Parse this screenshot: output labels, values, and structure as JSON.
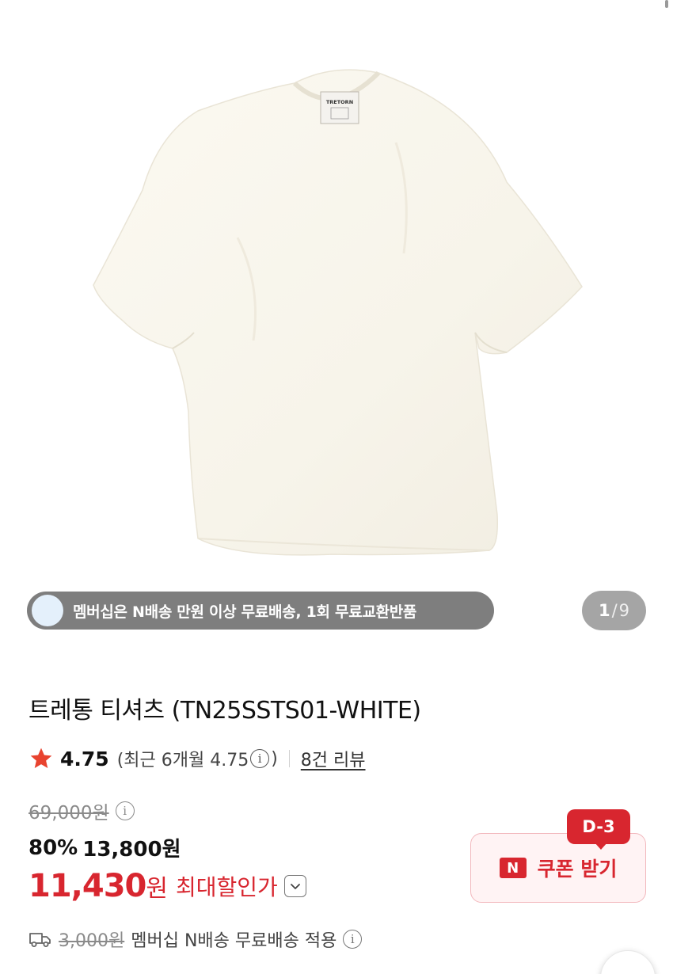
{
  "gallery": {
    "image_alt": "TRETORN",
    "membership_banner": "멤버십은 N배송 만원 이상 무료배송, 1회 무료교환반품",
    "counter": {
      "current": "1",
      "separator": "/",
      "total": "9"
    }
  },
  "product": {
    "title": "트레통 티셔츠 (TN25SSTS01-WHITE)",
    "rating": {
      "value": "4.75",
      "recent_prefix": "(최근 6개월 4.75",
      "recent_suffix": ")",
      "review_link": "8건 리뷰"
    },
    "price": {
      "original": "69,000원",
      "discount_rate": "80%",
      "sale_price": "13,800원",
      "max_discount_amount": "11,430",
      "max_discount_unit": "원",
      "max_discount_label": "최대할인가"
    },
    "shipping": {
      "old_fee": "3,000원",
      "text": "멤버십 N배송 무료배송 적용"
    },
    "coupon": {
      "badge": "D-3",
      "n_mark": "N",
      "label": "쿠폰 받기"
    }
  },
  "colors": {
    "accent_red": "#d8262f",
    "muted_gray": "#8a8a8a",
    "star": "#e8432f"
  },
  "icons": [
    "star-icon",
    "info-icon",
    "chevron-down-icon",
    "truck-icon"
  ]
}
